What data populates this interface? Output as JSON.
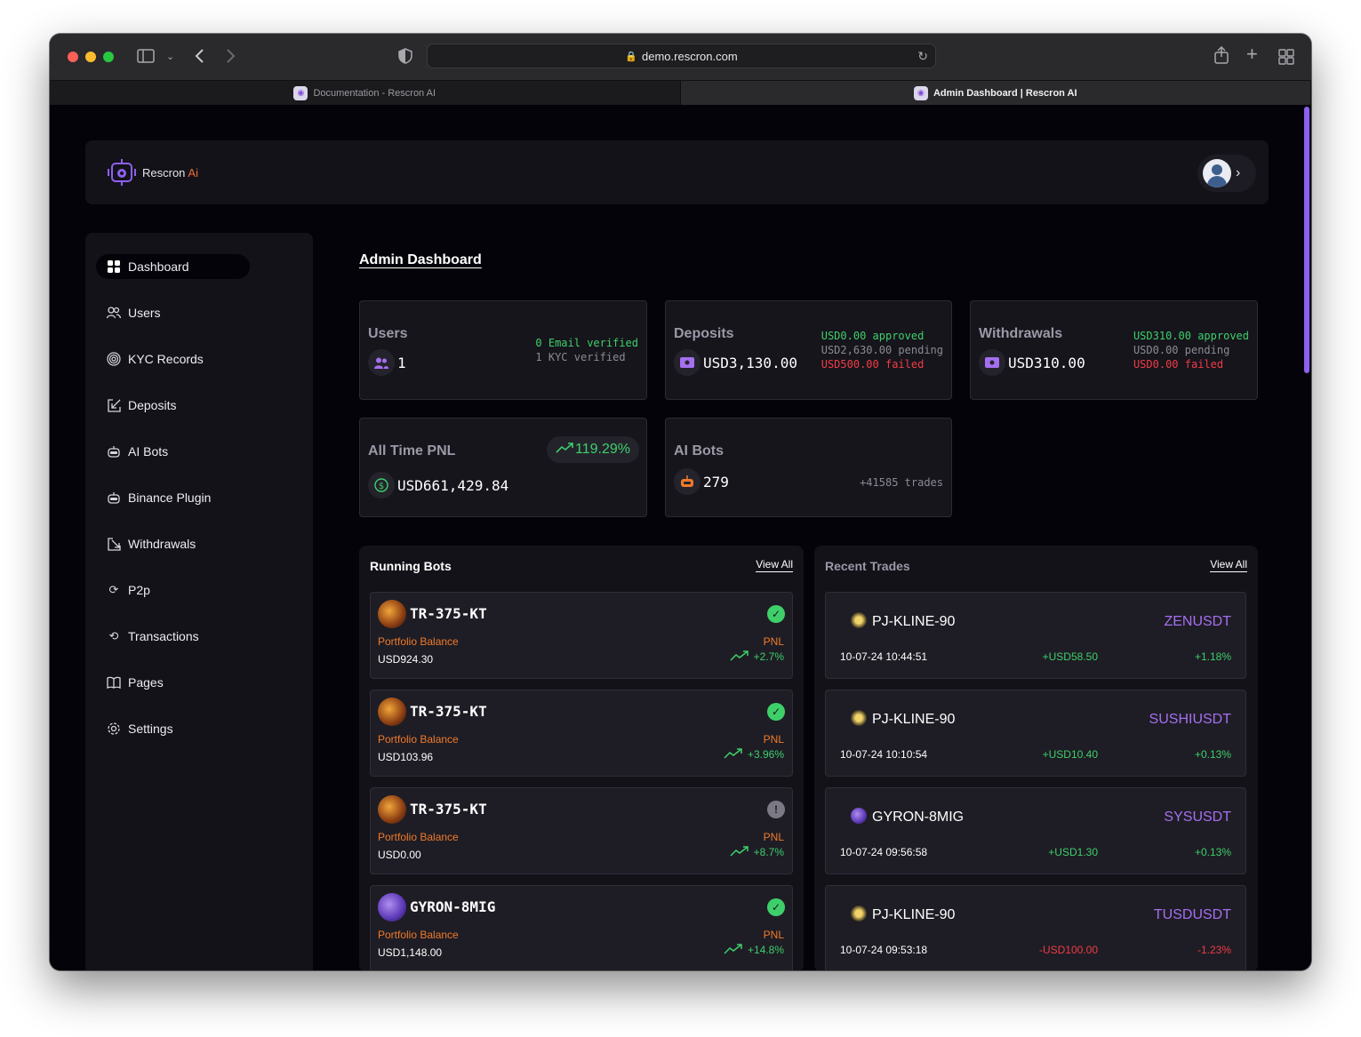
{
  "browser": {
    "url": "demo.rescron.com",
    "tabs": [
      {
        "title": "Documentation - Rescron AI",
        "active": false
      },
      {
        "title": "Admin Dashboard | Rescron AI",
        "active": true
      }
    ]
  },
  "brand": {
    "name": "Rescron",
    "suffix": "Ai",
    "accent": "#8e5ff0",
    "suffix_color": "#f06a3a"
  },
  "sidebar": {
    "items": [
      {
        "label": "Dashboard",
        "icon": "grid-icon",
        "active": true
      },
      {
        "label": "Users",
        "icon": "users-icon",
        "active": false
      },
      {
        "label": "KYC Records",
        "icon": "fingerprint-icon",
        "active": false
      },
      {
        "label": "Deposits",
        "icon": "deposit-icon",
        "active": false
      },
      {
        "label": "AI Bots",
        "icon": "robot-icon",
        "active": false
      },
      {
        "label": "Binance Plugin",
        "icon": "plugin-icon",
        "active": false
      },
      {
        "label": "Withdrawals",
        "icon": "withdraw-icon",
        "active": false
      },
      {
        "label": "P2p",
        "icon": "exchange-icon",
        "active": false
      },
      {
        "label": "Transactions",
        "icon": "transactions-icon",
        "active": false
      },
      {
        "label": "Pages",
        "icon": "book-icon",
        "active": false
      },
      {
        "label": "Settings",
        "icon": "gear-icon",
        "active": false
      }
    ]
  },
  "main": {
    "title": "Admin Dashboard",
    "cards": {
      "users": {
        "label": "Users",
        "value": "1",
        "line1": "0 Email verified",
        "line2": "1 KYC verified"
      },
      "deposits": {
        "label": "Deposits",
        "value": "USD3,130.00",
        "approved": "USD0.00 approved",
        "pending": "USD2,630.00 pending",
        "failed": "USD500.00 failed"
      },
      "withdrawals": {
        "label": "Withdrawals",
        "value": "USD310.00",
        "approved": "USD310.00 approved",
        "pending": "USD0.00 pending",
        "failed": "USD0.00 failed"
      },
      "pnl": {
        "label": "All Time PNL",
        "value": "USD661,429.84",
        "change": "119.29%"
      },
      "bots": {
        "label": "AI Bots",
        "value": "279",
        "trades": "+41585 trades"
      }
    },
    "running_bots": {
      "title": "Running Bots",
      "view_all": "View All",
      "portfolio_label": "Portfolio Balance",
      "pnl_label": "PNL",
      "items": [
        {
          "name": "TR-375-KT",
          "balance": "USD924.30",
          "pnl": "+2.7%",
          "status": "active",
          "avatar": "orange"
        },
        {
          "name": "TR-375-KT",
          "balance": "USD103.96",
          "pnl": "+3.96%",
          "status": "active",
          "avatar": "orange"
        },
        {
          "name": "TR-375-KT",
          "balance": "USD0.00",
          "pnl": "+8.7%",
          "status": "paused",
          "avatar": "orange"
        },
        {
          "name": "GYRON-8MIG",
          "balance": "USD1,148.00",
          "pnl": "+14.8%",
          "status": "active",
          "avatar": "purple"
        }
      ]
    },
    "recent_trades": {
      "title": "Recent Trades",
      "view_all": "View All",
      "items": [
        {
          "bot": "PJ-KLINE-90",
          "symbol": "ZENUSDT",
          "date": "10-07-24 10:44:51",
          "amount": "+USD58.50",
          "pct": "+1.18%",
          "positive": true,
          "icon": "gold"
        },
        {
          "bot": "PJ-KLINE-90",
          "symbol": "SUSHIUSDT",
          "date": "10-07-24 10:10:54",
          "amount": "+USD10.40",
          "pct": "+0.13%",
          "positive": true,
          "icon": "gold"
        },
        {
          "bot": "GYRON-8MIG",
          "symbol": "SYSUSDT",
          "date": "10-07-24 09:56:58",
          "amount": "+USD1.30",
          "pct": "+0.13%",
          "positive": true,
          "icon": "purple"
        },
        {
          "bot": "PJ-KLINE-90",
          "symbol": "TUSDUSDT",
          "date": "10-07-24 09:53:18",
          "amount": "-USD100.00",
          "pct": "-1.23%",
          "positive": false,
          "icon": "gold"
        }
      ]
    }
  }
}
